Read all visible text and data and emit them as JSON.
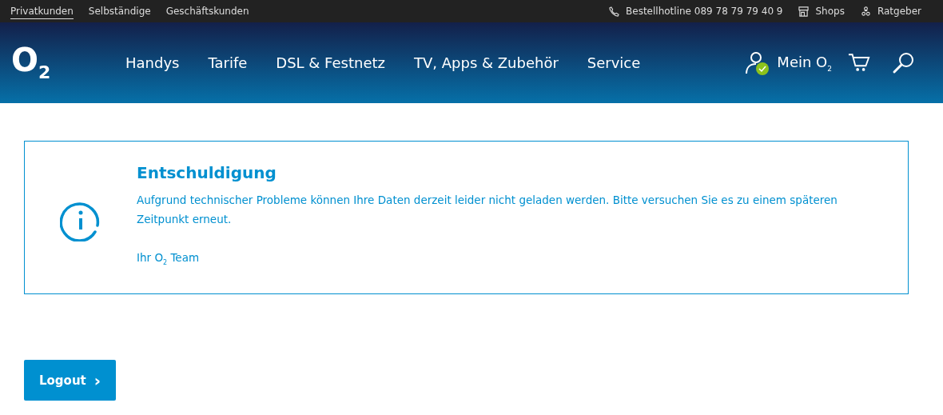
{
  "top_bar": {
    "segments": [
      {
        "label": "Privatkunden",
        "selected": true
      },
      {
        "label": "Selbständige",
        "selected": false
      },
      {
        "label": "Geschäftskunden",
        "selected": false
      }
    ],
    "links": [
      {
        "kind": "phone",
        "label": "Bestellhotline 089 78 79 79 40 9"
      },
      {
        "kind": "shop",
        "label": "Shops"
      },
      {
        "kind": "guide",
        "label": "Ratgeber"
      }
    ]
  },
  "header": {
    "logo": "O$_{2}$",
    "nav": [
      "Handys",
      "Tarife",
      "DSL & Festnetz",
      "TV, Apps & Zubehör",
      "Service"
    ],
    "account": {
      "label": "Mein O$_{2}$",
      "logged_in": true
    }
  },
  "message": {
    "title": "Entschuldigung",
    "text": "Aufgrund technischer Probleme können Ihre Daten derzeit leider nicht geladen werden. Bitte versuchen Sie es zu einem späteren Zeitpunkt erneut.",
    "signature": "Ihr O$_{2}$ Team"
  },
  "logout_button": {
    "label": "Logout",
    "arrow": "›"
  }
}
